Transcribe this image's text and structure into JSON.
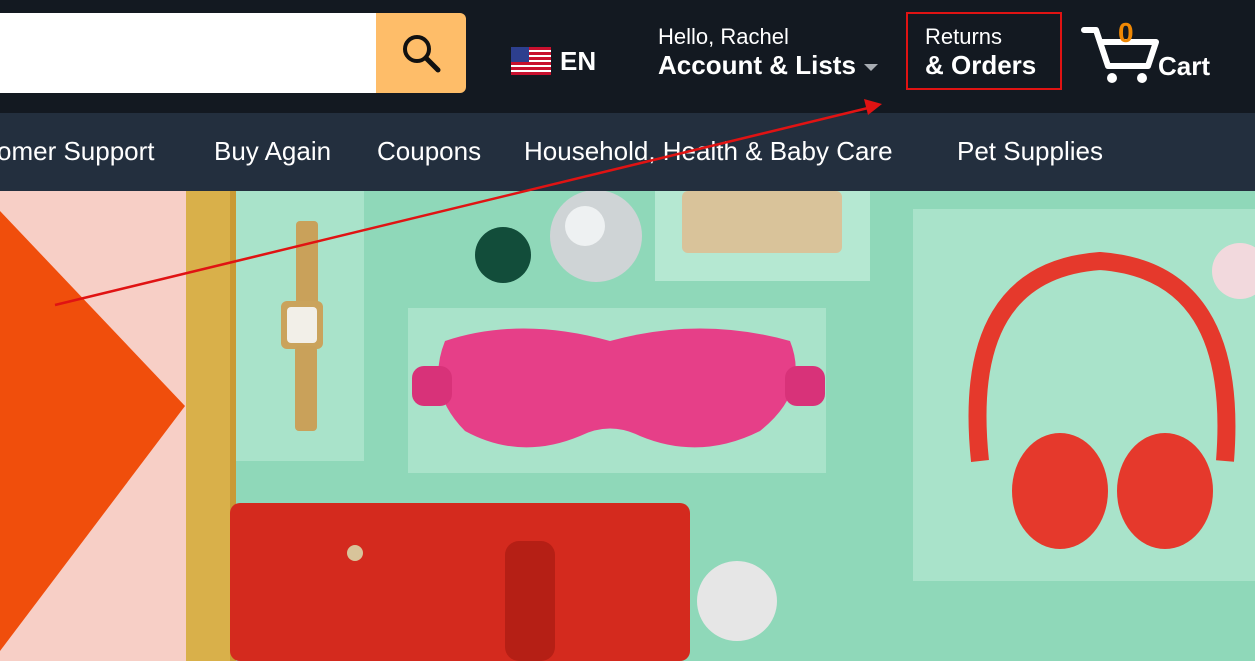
{
  "search": {
    "value": "",
    "placeholder": ""
  },
  "language": {
    "code": "EN",
    "flag_icon": "us-flag-icon"
  },
  "account": {
    "greeting": "Hello, Rachel",
    "label": "Account & Lists"
  },
  "returns": {
    "top": "Returns",
    "label": "& Orders"
  },
  "cart": {
    "count": "0",
    "label": "Cart"
  },
  "nav": {
    "items": [
      "omer Support",
      "Buy Again",
      "Coupons",
      "Household, Health & Baby Care",
      "Pet Supplies"
    ]
  },
  "colors": {
    "header_bg": "#131921",
    "nav_bg": "#232f3e",
    "search_button": "#febd69",
    "cart_count": "#f08804",
    "highlight": "#e01313"
  }
}
